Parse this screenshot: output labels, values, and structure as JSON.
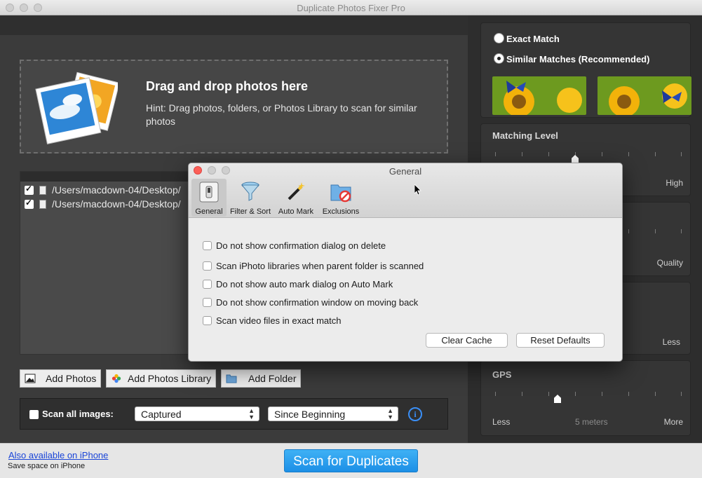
{
  "window": {
    "title": "Duplicate Photos Fixer Pro"
  },
  "dropzone": {
    "title": "Drag and drop photos here",
    "hint": "Hint: Drag photos, folders, or Photos Library to scan for similar photos"
  },
  "files": [
    {
      "path": "/Users/macdown-04/Desktop/",
      "checked": true
    },
    {
      "path": "/Users/macdown-04/Desktop/",
      "checked": true
    }
  ],
  "buttons": {
    "add_photos": "Add Photos",
    "add_library": "Add Photos Library",
    "add_folder": "Add Folder"
  },
  "scan_options": {
    "scan_all_label": "Scan all images:",
    "captured": "Captured",
    "since": "Since Beginning"
  },
  "match": {
    "exact": "Exact Match",
    "similar": "Similar Matches (Recommended)",
    "selected": "similar"
  },
  "sliders": {
    "matching_level_title": "Matching Level",
    "matching_high": "High",
    "quality_label": "Quality",
    "less_label": "Less",
    "gps_title": "GPS",
    "gps_less": "Less",
    "gps_value": "5 meters",
    "gps_more": "More"
  },
  "bottom": {
    "iphone_link": "Also available on iPhone",
    "iphone_sub": "Save space on iPhone",
    "scan_button": "Scan for Duplicates"
  },
  "dialog": {
    "title": "General",
    "tabs": [
      "General",
      "Filter & Sort",
      "Auto Mark",
      "Exclusions"
    ],
    "options": [
      "Do not show confirmation dialog on delete",
      "Scan iPhoto libraries when parent folder is scanned",
      "Do not show auto mark dialog on Auto Mark",
      "Do not show confirmation window on moving back",
      "Scan video files in exact match"
    ],
    "clear_cache": "Clear Cache",
    "reset_defaults": "Reset Defaults"
  },
  "colors": {
    "accent": "#1c8fe6",
    "link": "#1a45d8"
  }
}
